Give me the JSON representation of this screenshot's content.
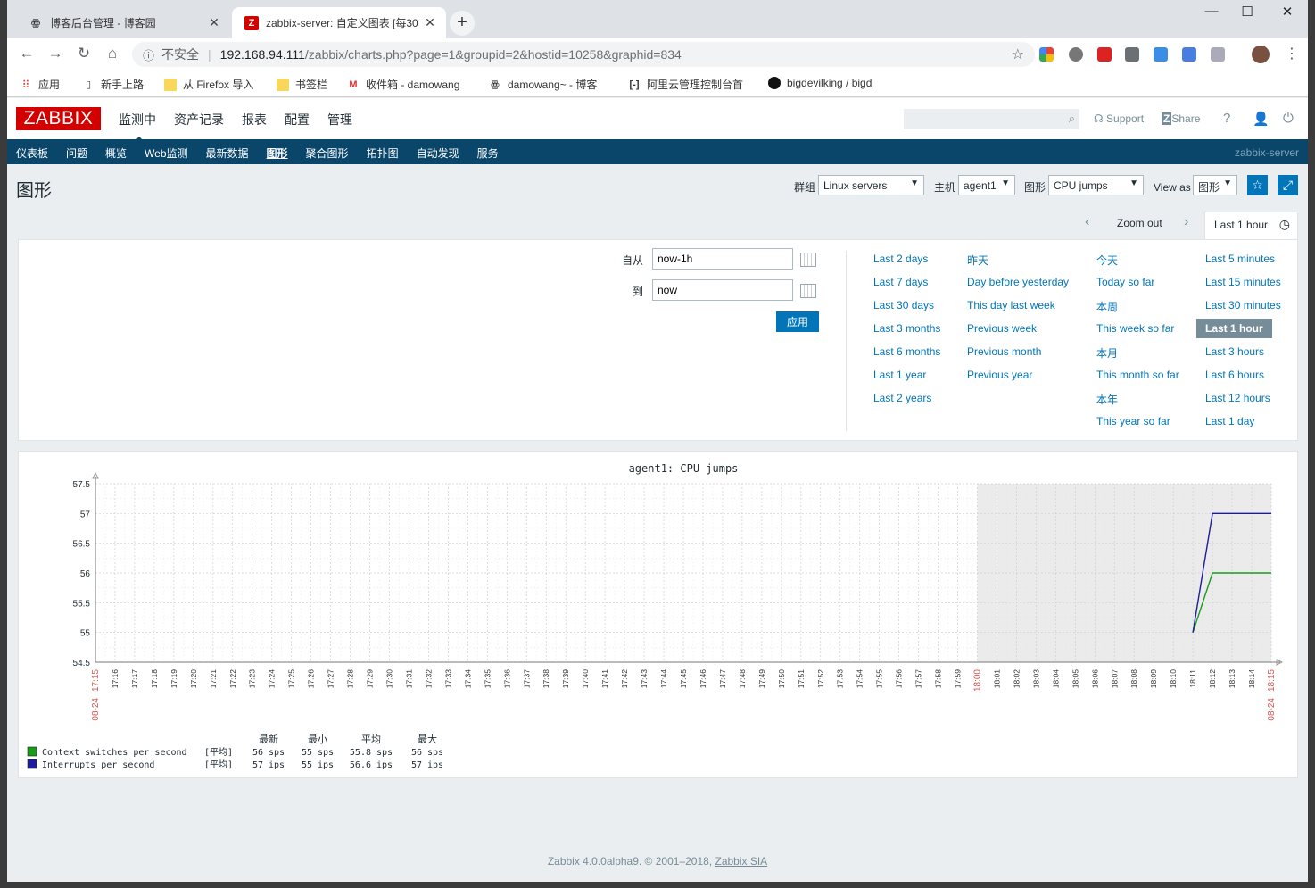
{
  "browser": {
    "tabs": [
      {
        "title": "博客后台管理 - 博客园",
        "active": false
      },
      {
        "title": "zabbix-server: 自定义图表 [每30",
        "active": true
      }
    ],
    "security_label": "不安全",
    "url_host": "192.168.94.111",
    "url_path": "/zabbix/charts.php?page=1&groupid=2&hostid=10258&graphid=834",
    "bookmarks": [
      "应用",
      "新手上路",
      "从 Firefox 导入",
      "书签栏",
      "收件箱 - damowang",
      "damowang~ - 博客",
      "阿里云管理控制台首",
      "bigdevilking / bigd"
    ]
  },
  "header": {
    "logo": "ZABBIX",
    "menu": [
      "监测中",
      "资产记录",
      "报表",
      "配置",
      "管理"
    ],
    "support": "Support",
    "share": "Share",
    "help": "?"
  },
  "subnav": {
    "items": [
      "仪表板",
      "问题",
      "概览",
      "Web监测",
      "最新数据",
      "图形",
      "聚合图形",
      "拓扑图",
      "自动发现",
      "服务"
    ],
    "server": "zabbix-server"
  },
  "page": {
    "title": "图形",
    "filters": {
      "group_label": "群组",
      "group_value": "Linux servers",
      "host_label": "主机",
      "host_value": "agent1",
      "graph_label": "图形",
      "graph_value": "CPU jumps",
      "view_label": "View as",
      "view_value": "图形"
    }
  },
  "time": {
    "zoom_out": "Zoom out",
    "selected_tab": "Last 1 hour",
    "from_label": "自从",
    "from_value": "now-1h",
    "to_label": "到",
    "to_value": "now",
    "apply": "应用",
    "quick": [
      [
        "Last 2 days",
        "Last 7 days",
        "Last 30 days",
        "Last 3 months",
        "Last 6 months",
        "Last 1 year",
        "Last 2 years"
      ],
      [
        "昨天",
        "Day before yesterday",
        "This day last week",
        "Previous week",
        "Previous month",
        "Previous year"
      ],
      [
        "今天",
        "Today so far",
        "本周",
        "This week so far",
        "本月",
        "This month so far",
        "本年",
        "This year so far"
      ],
      [
        "Last 5 minutes",
        "Last 15 minutes",
        "Last 30 minutes",
        "Last 1 hour",
        "Last 3 hours",
        "Last 6 hours",
        "Last 12 hours",
        "Last 1 day"
      ]
    ]
  },
  "chart_data": {
    "type": "line",
    "title": "agent1: CPU jumps",
    "ylim": [
      54.5,
      57.5
    ],
    "yticks": [
      "57.5",
      "57",
      "56.5",
      "56",
      "55.5",
      "55",
      "54.5"
    ],
    "xticks": [
      "17:15",
      "17:16",
      "17:17",
      "17:18",
      "17:19",
      "17:20",
      "17:21",
      "17:22",
      "17:23",
      "17:24",
      "17:25",
      "17:26",
      "17:27",
      "17:28",
      "17:29",
      "17:30",
      "17:31",
      "17:32",
      "17:33",
      "17:34",
      "17:35",
      "17:36",
      "17:37",
      "17:38",
      "17:39",
      "17:40",
      "17:41",
      "17:42",
      "17:43",
      "17:44",
      "17:45",
      "17:46",
      "17:47",
      "17:48",
      "17:49",
      "17:50",
      "17:51",
      "17:52",
      "17:53",
      "17:54",
      "17:55",
      "17:56",
      "17:57",
      "17:58",
      "17:59",
      "18:00",
      "18:01",
      "18:02",
      "18:03",
      "18:04",
      "18:05",
      "18:06",
      "18:07",
      "18:08",
      "18:09",
      "18:10",
      "18:11",
      "18:12",
      "18:13",
      "18:14",
      "18:15"
    ],
    "start_date": "08-24",
    "end_date": "08-24",
    "shaded_from": "18:00",
    "series": [
      {
        "name": "Context switches per second",
        "color": "#1a9b1a",
        "points": [
          [
            "18:11",
            55
          ],
          [
            "18:12",
            56
          ],
          [
            "18:15",
            56
          ]
        ]
      },
      {
        "name": "Interrupts per second",
        "color": "#1c1c9c",
        "points": [
          [
            "18:11",
            55
          ],
          [
            "18:12",
            57
          ],
          [
            "18:15",
            57
          ]
        ]
      }
    ],
    "legend": {
      "headers": [
        "最新",
        "最小",
        "平均",
        "最大"
      ],
      "rows": [
        {
          "name": "Context switches per second",
          "func": "[平均]",
          "last": "56 sps",
          "min": "55 sps",
          "avg": "55.8 sps",
          "max": "56 sps",
          "color": "#1a9b1a"
        },
        {
          "name": "Interrupts per second",
          "func": "[平均]",
          "last": "57 ips",
          "min": "55 ips",
          "avg": "56.6 ips",
          "max": "57 ips",
          "color": "#1c1c9c"
        }
      ]
    }
  },
  "footer": {
    "text": "Zabbix 4.0.0alpha9. © 2001–2018,",
    "link": "Zabbix SIA"
  }
}
